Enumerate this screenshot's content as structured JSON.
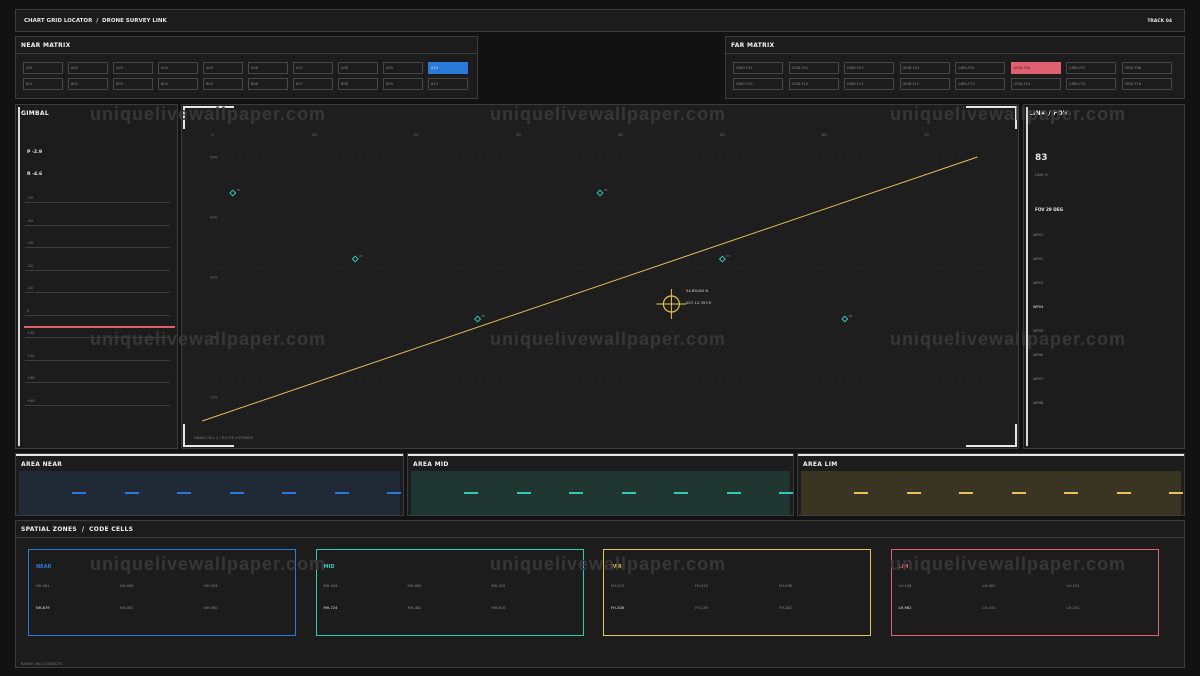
{
  "header": {
    "title": "CHART GRID LOCATOR",
    "separator": "/",
    "subtitle": "DRONE SURVEY LINK",
    "track": "TRACK 04"
  },
  "watermark": "uniquelivewallpaper.com",
  "near_matrix": {
    "title": "NEAR MATRIX",
    "cells": [
      "A01",
      "A02",
      "A03",
      "A04",
      "A05",
      "A06",
      "A07",
      "A08",
      "A09",
      "A10",
      "B01",
      "B02",
      "B03",
      "B04",
      "B05",
      "B06",
      "B07",
      "B08",
      "B09",
      "B10"
    ],
    "active_index": 9
  },
  "far_matrix": {
    "title": "FAR MATRIX",
    "cells": [
      "GRID-F01",
      "GRID-F02",
      "GRID-F03",
      "GRID-F04",
      "GRID-F05",
      "GRID-F06",
      "GRID-F07",
      "GRID-F08",
      "GRID-F09",
      "GRID-F10",
      "GRID-F11",
      "GRID-F12",
      "GRID-F13",
      "GRID-F14",
      "GRID-F15",
      "GRID-F16"
    ],
    "alert_index": 5,
    "alert_color": "#e06070"
  },
  "gimbal": {
    "title": "GIMBAL",
    "pitch": "P -2.9",
    "roll": "R -4.6",
    "ticks": [
      "-50",
      "-40",
      "-30",
      "-20",
      "-10",
      "0",
      "+10",
      "+20",
      "+30",
      "+40"
    ],
    "marker_color": "#e06070"
  },
  "link": {
    "title": "LINK / FOV",
    "value": "83",
    "value_label": "LINK %",
    "fov": "FOV 29 DEG",
    "ticks": [
      "WP01",
      "WP02",
      "WP03",
      "WP04",
      "WP05",
      "WP06",
      "WP07",
      "WP08"
    ],
    "selected": "WP04"
  },
  "plot": {
    "corner_label": "DRAW CELL 2 / ROUTE ESTIMATE",
    "crosshair_lat": "54.89180 N",
    "crosshair_lon": "007.12.353 E"
  },
  "chart_data": {
    "type": "scatter",
    "title": "",
    "xlabel": "",
    "ylabel": "",
    "x_ticks": [
      "0",
      "10",
      "20",
      "30",
      "40",
      "50",
      "60",
      "70"
    ],
    "y_ticks": [
      "500",
      "400",
      "300",
      "200",
      "100"
    ],
    "xlim": [
      -2,
      78
    ],
    "ylim": [
      50,
      550
    ],
    "grid": true,
    "series": [
      {
        "kind": "points",
        "color": "#2fc9b6",
        "values": [
          {
            "x": 2,
            "y": 440,
            "label": "P1"
          },
          {
            "x": 14,
            "y": 330,
            "label": "P2"
          },
          {
            "x": 26,
            "y": 230,
            "label": "P3"
          },
          {
            "x": 38,
            "y": 440,
            "label": "P4"
          },
          {
            "x": 50,
            "y": 330,
            "label": "P5"
          },
          {
            "x": 62,
            "y": 230,
            "label": "P6"
          }
        ]
      },
      {
        "kind": "line",
        "color": "#e8c15a",
        "values": [
          {
            "x": -1,
            "y": 60
          },
          {
            "x": 75,
            "y": 500
          }
        ]
      }
    ],
    "crosshair": {
      "x": 45,
      "y": 255,
      "color": "#e8c15a"
    }
  },
  "areas": [
    {
      "title": "AREA NEAR",
      "color": "#2b7ad8",
      "fill": "#1f2a36"
    },
    {
      "title": "AREA MID",
      "color": "#2fc9b6",
      "fill": "#1f3530"
    },
    {
      "title": "AREA LIM",
      "color": "#e8c15a",
      "fill": "#3a3422"
    }
  ],
  "zones": {
    "title": "SPATIAL ZONES",
    "separator": "/",
    "subtitle": "CODE CELLS",
    "footer": "RANGE 060 CONTACTS",
    "items": [
      {
        "title": "NEAR",
        "color": "#2b7ad8",
        "codes": [
          "NH-061",
          "NH-068",
          "NH-093",
          "NH-879",
          "NH-081",
          "NH-060"
        ],
        "hi": 3
      },
      {
        "title": "MID",
        "color": "#2fc9b6",
        "codes": [
          "MH-504",
          "MH-680",
          "MH-432",
          "MH-724",
          "MH-462",
          "MH-816"
        ],
        "hi": 3
      },
      {
        "title": "FAR",
        "color": "#e8c15a",
        "codes": [
          "FH-203",
          "FH-515",
          "FH-098",
          "FH-208",
          "FH-239",
          "FH-282"
        ],
        "hi": 3
      },
      {
        "title": "LIM",
        "color": "#e06070",
        "codes": [
          "LH-106",
          "LH-481",
          "LH-125",
          "LH-962",
          "LH-150",
          "LH-201"
        ],
        "hi": 3
      }
    ]
  }
}
